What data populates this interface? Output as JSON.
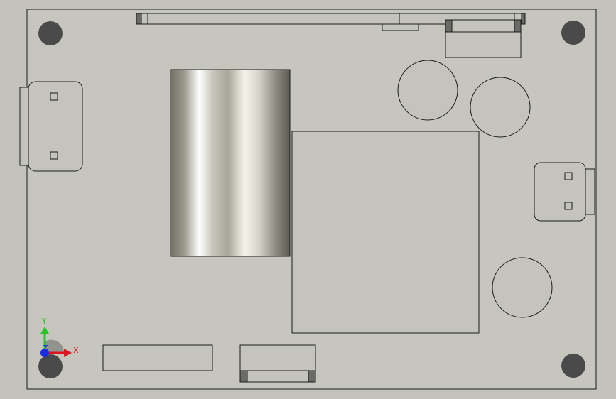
{
  "triad": {
    "x_label": "X",
    "y_label": "Y",
    "z_label": "Z",
    "x_color": "#e0141e",
    "y_color": "#27c22a",
    "z_color": "#1a2ee0"
  },
  "colors": {
    "background": "#c3c3bb",
    "board": "#c6c6bf",
    "outline": "#1a1a1a",
    "mount_hole": "#4a4a4a"
  }
}
